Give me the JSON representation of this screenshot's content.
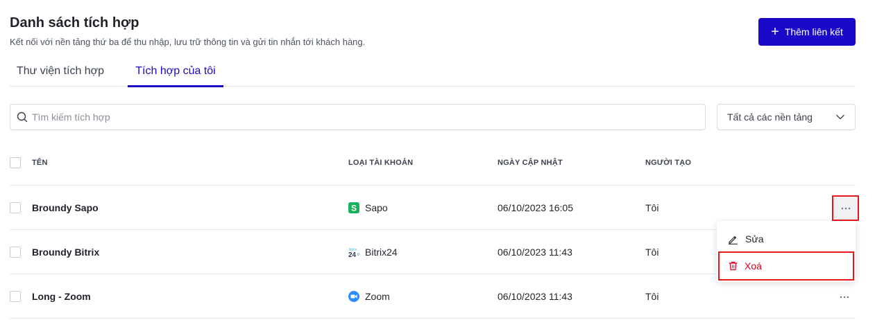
{
  "header": {
    "title": "Danh sách tích hợp",
    "subtitle": "Kết nối với nền tảng thứ ba để thu nhập, lưu trữ thông tin và gửi tin nhắn tới khách hàng.",
    "add_button_label": "Thêm liên kết"
  },
  "tabs": [
    {
      "label": "Thư viện tích hợp",
      "active": false
    },
    {
      "label": "Tích hợp của tôi",
      "active": true
    }
  ],
  "search": {
    "placeholder": "Tìm kiếm tích hợp",
    "value": ""
  },
  "platform_filter": {
    "selected": "Tất cả các nền tảng"
  },
  "table": {
    "columns": [
      "TÊN",
      "LOẠI TÀI KHOẢN",
      "NGÀY CẬP NHẬT",
      "NGƯỜI TẠO"
    ],
    "rows": [
      {
        "name": "Broundy Sapo",
        "account_type": "Sapo",
        "account_icon": "sapo-logo-icon",
        "updated": "06/10/2023 16:05",
        "creator": "Tôi"
      },
      {
        "name": "Broundy Bitrix",
        "account_type": "Bitrix24",
        "account_icon": "bitrix24-logo-icon",
        "updated": "06/10/2023 11:43",
        "creator": "Tôi"
      },
      {
        "name": "Long - Zoom",
        "account_type": "Zoom",
        "account_icon": "zoom-logo-icon",
        "updated": "06/10/2023 11:43",
        "creator": "Tôi"
      }
    ]
  },
  "context_menu": {
    "edit_label": "Sửa",
    "delete_label": "Xoá"
  },
  "colors": {
    "primary": "#1a09c9",
    "danger": "#d0021b",
    "highlight": "#e4161f",
    "sapo": "#17b35a",
    "zoom": "#2d8cff",
    "bitrix": "#2fc6f6"
  }
}
